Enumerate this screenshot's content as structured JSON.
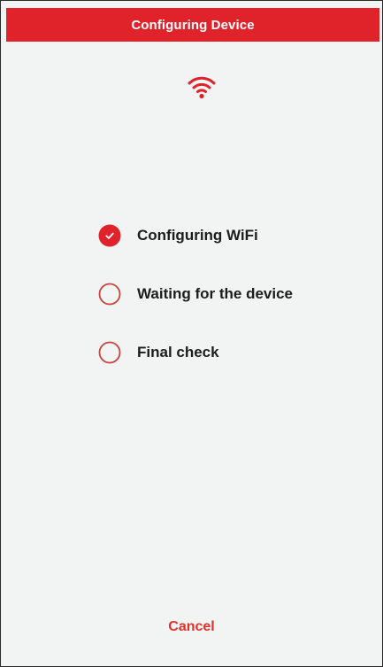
{
  "theme": {
    "accent": "#e0232b",
    "background": "#f2f3f3",
    "text": "#1c1c1c"
  },
  "header": {
    "title": "Configuring Device"
  },
  "status_icon": {
    "name": "wifi-icon"
  },
  "steps": [
    {
      "label": "Configuring WiFi",
      "state": "done",
      "icon": "check-circle-icon"
    },
    {
      "label": "Waiting for the device",
      "state": "pending",
      "icon": "empty-circle-icon"
    },
    {
      "label": "Final check",
      "state": "pending",
      "icon": "empty-circle-icon"
    }
  ],
  "footer": {
    "cancel_label": "Cancel"
  }
}
